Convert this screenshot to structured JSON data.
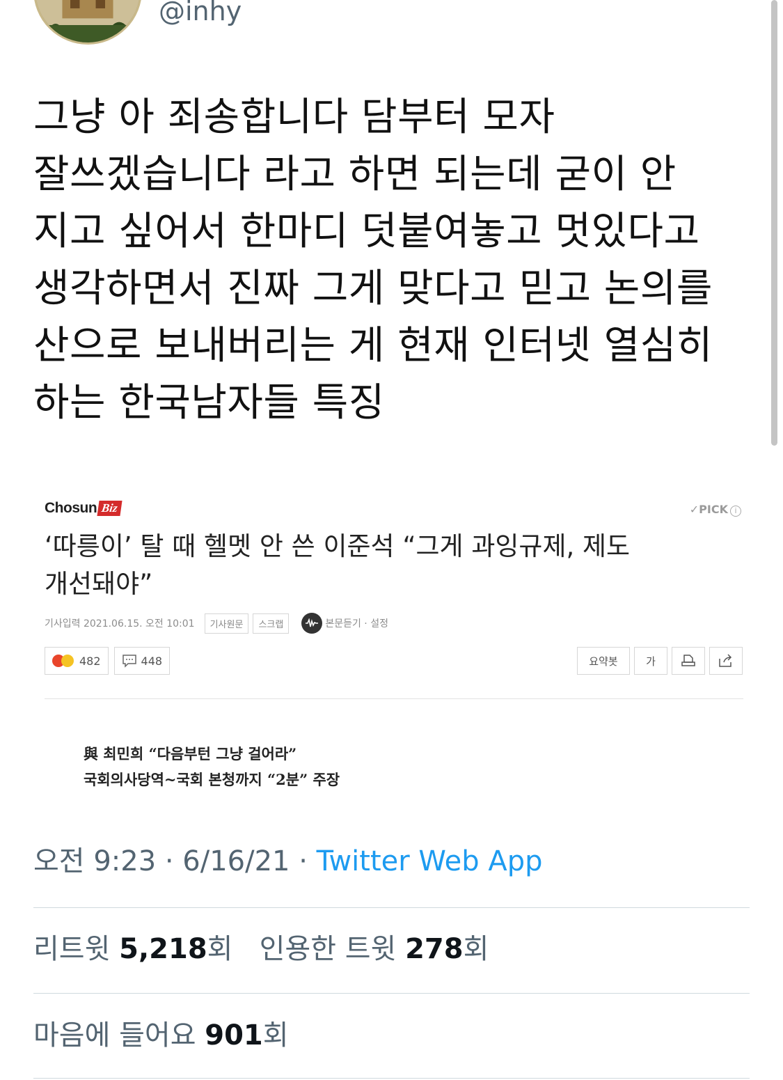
{
  "profile": {
    "handle": "@inhy"
  },
  "tweet": {
    "text": "그냥 아 죄송합니다 담부터 모자 잘쓰겠습니다 라고 하면 되는데 굳이 안 지고 싶어서 한마디 덧붙여놓고 멋있다고 생각하면서 진짜 그게 맞다고 믿고 논의를 산으로 보내버리는 게 현재 인터넷 열심히 하는 한국남자들 특징"
  },
  "article": {
    "brand": "Chosun",
    "brand_suffix": "Biz",
    "pick": "✓PICK",
    "pick_info": "i",
    "headline": "‘따릉이’ 탈 때 헬멧 안 쓴 이준석 “그게 과잉규제, 제도 개선돼야”",
    "date": "기사입력 2021.06.15. 오전 10:01",
    "tag_original": "기사원문",
    "tag_scrap": "스크랩",
    "listen": "본문듣기 · 설정",
    "reaction_count": "482",
    "comment_count": "448",
    "tool_summary": "요약봇",
    "tool_font": "가",
    "subheads": [
      "與 최민희 “다음부턴 그냥 걸어라”",
      "국회의사당역~국회 본청까지 “2분” 주장"
    ]
  },
  "timestamp": {
    "time": "오전 9:23",
    "sep": " · ",
    "date": "6/16/21",
    "source": "Twitter Web App"
  },
  "stats": {
    "retweet_label": "리트윗 ",
    "retweet_count": "5,218",
    "retweet_suffix": "회",
    "quote_label": "인용한 트윗 ",
    "quote_count": "278",
    "quote_suffix": "회",
    "like_label": "마음에 들어요 ",
    "like_count": "901",
    "like_suffix": "회"
  },
  "colors": {
    "link": "#1d9bf0",
    "muted": "#536471",
    "brand_red": "#d42b2b"
  }
}
